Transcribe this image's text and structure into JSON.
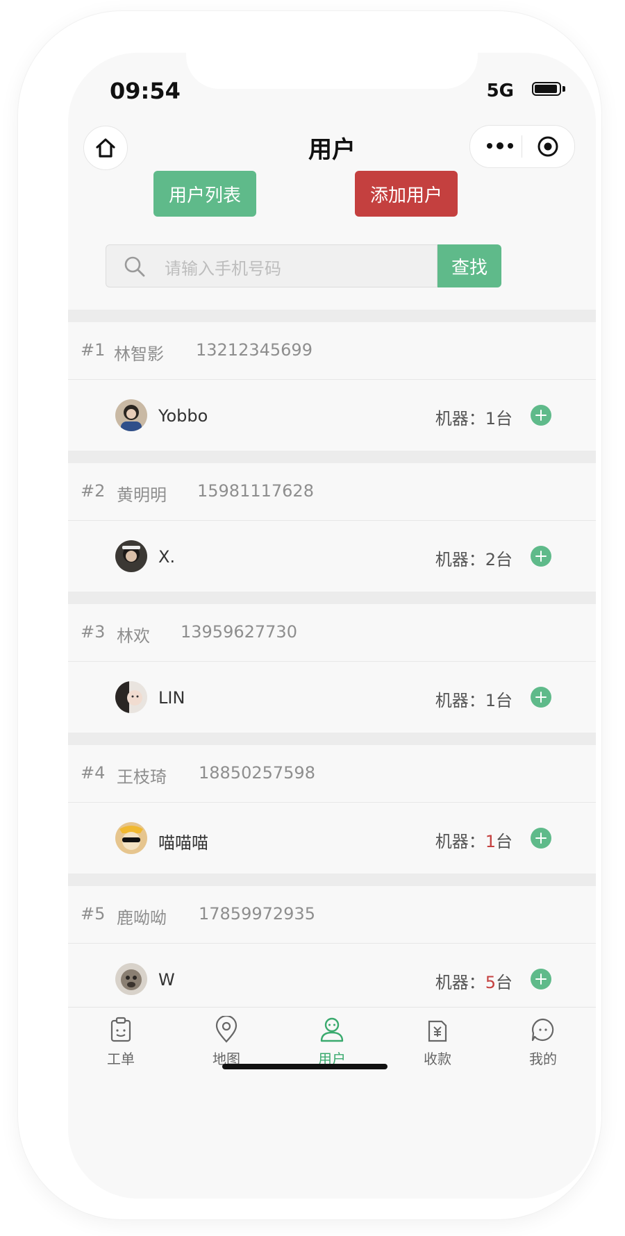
{
  "status": {
    "time": "09:54",
    "network": "5G"
  },
  "nav": {
    "title": "用户"
  },
  "tabs": {
    "list": "用户列表",
    "add": "添加用户"
  },
  "search": {
    "placeholder": "请输入手机号码",
    "button": "查找"
  },
  "users": [
    {
      "index": "#1",
      "name": "林智影",
      "phone": "13212345699",
      "nick": "Yobbo",
      "machine_label": "机器：",
      "count": "1",
      "unit": "台",
      "count_highlight": false
    },
    {
      "index": "#2",
      "name": "黄明明",
      "phone": "15981117628",
      "nick": "X.",
      "machine_label": "机器：",
      "count": "2",
      "unit": "台",
      "count_highlight": false
    },
    {
      "index": "#3",
      "name": "林欢",
      "phone": "13959627730",
      "nick": "LIN",
      "machine_label": "机器：",
      "count": "1",
      "unit": "台",
      "count_highlight": false
    },
    {
      "index": "#4",
      "name": "王枝琦",
      "phone": "18850257598",
      "nick": "喵喵喵",
      "machine_label": "机器：",
      "count": "1",
      "unit": "台",
      "count_highlight": true
    },
    {
      "index": "#5",
      "name": "鹿呦呦",
      "phone": "17859972935",
      "nick": "W",
      "machine_label": "机器：",
      "count": "5",
      "unit": "台",
      "count_highlight": true
    }
  ],
  "tabbar": [
    {
      "label": "工单",
      "icon": "clipboard-icon"
    },
    {
      "label": "地图",
      "icon": "map-pin-icon"
    },
    {
      "label": "用户",
      "icon": "user-icon",
      "active": true
    },
    {
      "label": "收款",
      "icon": "payment-icon"
    },
    {
      "label": "我的",
      "icon": "chat-icon"
    }
  ],
  "colors": {
    "accent": "#5fba8a",
    "danger": "#c4403f"
  }
}
